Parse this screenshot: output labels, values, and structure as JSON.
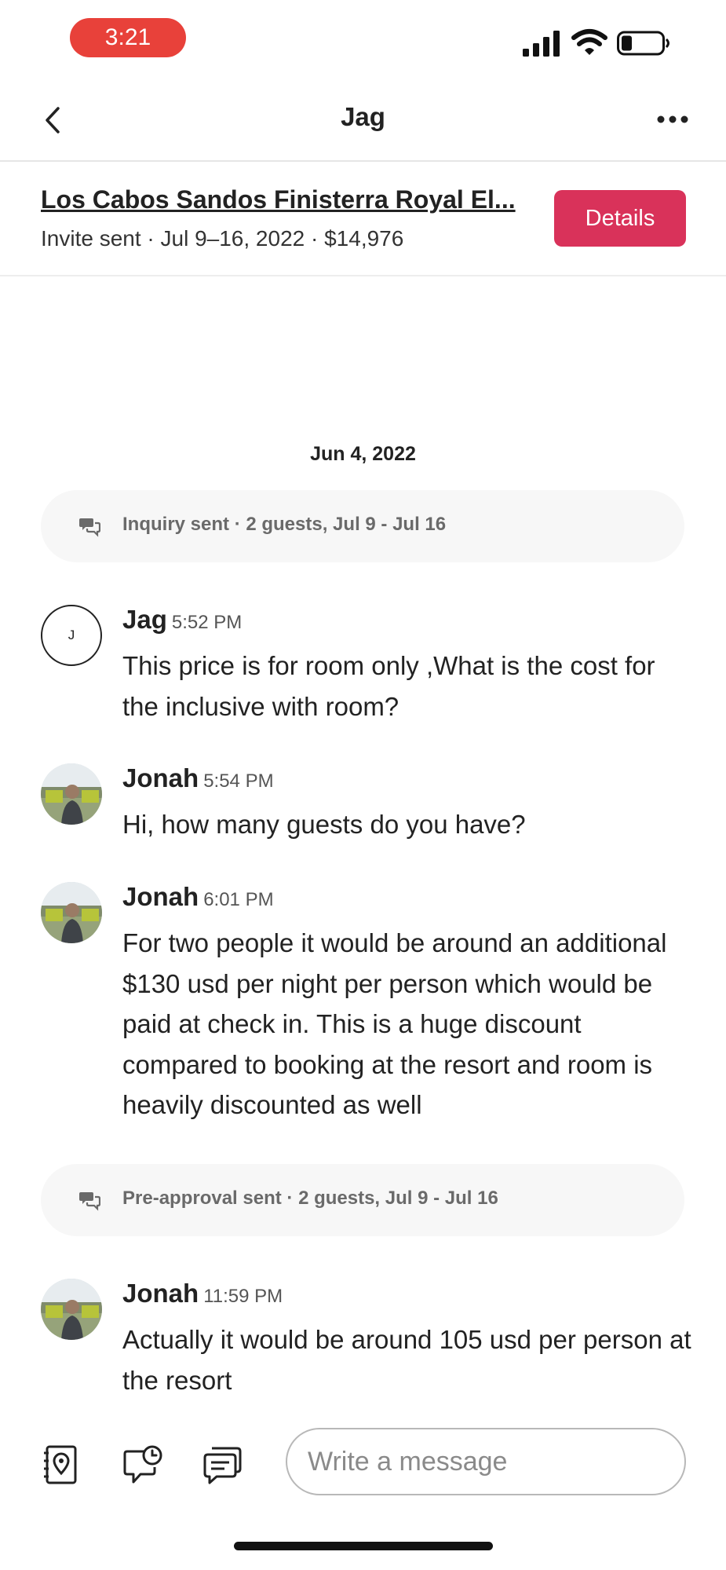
{
  "status_bar": {
    "time": "3:21"
  },
  "header": {
    "title": "Jag",
    "back_icon": "chevron-left-icon",
    "more_icon": "more-dots-icon"
  },
  "listing": {
    "title": "Los Cabos Sandos Finisterra Royal El...",
    "subtitle": "Invite sent · Jul 9–16, 2022 · $14,976",
    "details_label": "Details",
    "accent_color": "#d9325a"
  },
  "thread": {
    "date": "Jun 4, 2022",
    "events": [
      {
        "icon": "chat-bubbles-icon",
        "text": "Inquiry sent · 2 guests, Jul 9 - Jul 16"
      },
      {
        "icon": "chat-bubbles-icon",
        "text": "Pre-approval sent · 2 guests, Jul 9 - Jul 16"
      }
    ],
    "messages": [
      {
        "sender": "Jag",
        "initial": "J",
        "time": "5:52 PM",
        "text": "This price is for room only ,What is the cost for the inclusive with room?"
      },
      {
        "sender": "Jonah",
        "time": "5:54 PM",
        "text": "Hi, how many guests do you have?"
      },
      {
        "sender": "Jonah",
        "time": "6:01 PM",
        "text": "For two people it would be around an additional $130 usd per night per person which would be paid at check in. This is a huge discount compared to booking at the resort and room is heavily discounted as well"
      },
      {
        "sender": "Jonah",
        "time": "11:59 PM",
        "text": "Actually it would be around 105 usd per person at the resort"
      }
    ]
  },
  "composer": {
    "placeholder": "Write a message",
    "tools": [
      "guidebook-location-icon",
      "scheduled-message-icon",
      "quick-reply-icon"
    ]
  }
}
